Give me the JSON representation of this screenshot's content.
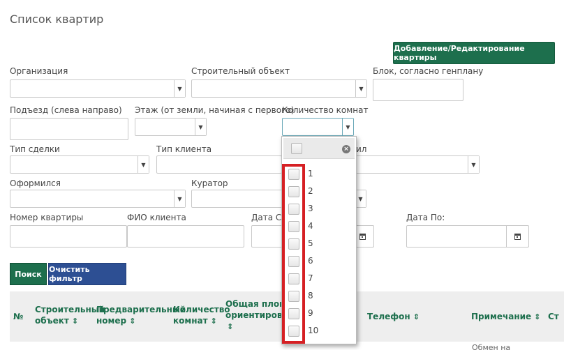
{
  "page_title": "Список квартир",
  "add_button_label": "Добавление/Редактирование квартиры",
  "filters": {
    "organization_label": "Организация",
    "building_label": "Строительный объект",
    "block_label": "Блок, согласно генплану",
    "entrance_label": "Подъезд (слева направо)",
    "floor_label": "Этаж (от земли, начиная с первого)",
    "rooms_label": "Количество комнат",
    "deal_type_label": "Тип сделки",
    "client_type_label": "Тип клиента",
    "partial_label": "ил",
    "registered_label": "Оформился",
    "curator_label": "Куратор",
    "apartment_number_label": "Номер квартиры",
    "client_name_label": "ФИО клиента",
    "date_from_label": "Дата С:",
    "date_to_label": "Дата По:"
  },
  "search_button_label": "Поиск",
  "clear_button_label": "Очистить фильтр",
  "table": {
    "col_num": "№",
    "col_building_1": "Строительный",
    "col_building_2": "объект",
    "col_prelim_1": "Предварительный",
    "col_prelim_2": "номер",
    "col_rooms_1": "Количество",
    "col_rooms_2": "комнат",
    "col_area_1": "Общая площадь",
    "col_area_2": "ориентировочн",
    "col_phone": "Телефон",
    "col_note": "Примечание",
    "col_more": "Ст",
    "partial_cell": "Обмен на"
  },
  "rooms_options": [
    "1",
    "2",
    "3",
    "4",
    "5",
    "6",
    "7",
    "8",
    "9",
    "10"
  ],
  "colors": {
    "primary_green": "#1d6f4d",
    "primary_blue": "#2d4f93",
    "highlight_red": "#d62024"
  }
}
